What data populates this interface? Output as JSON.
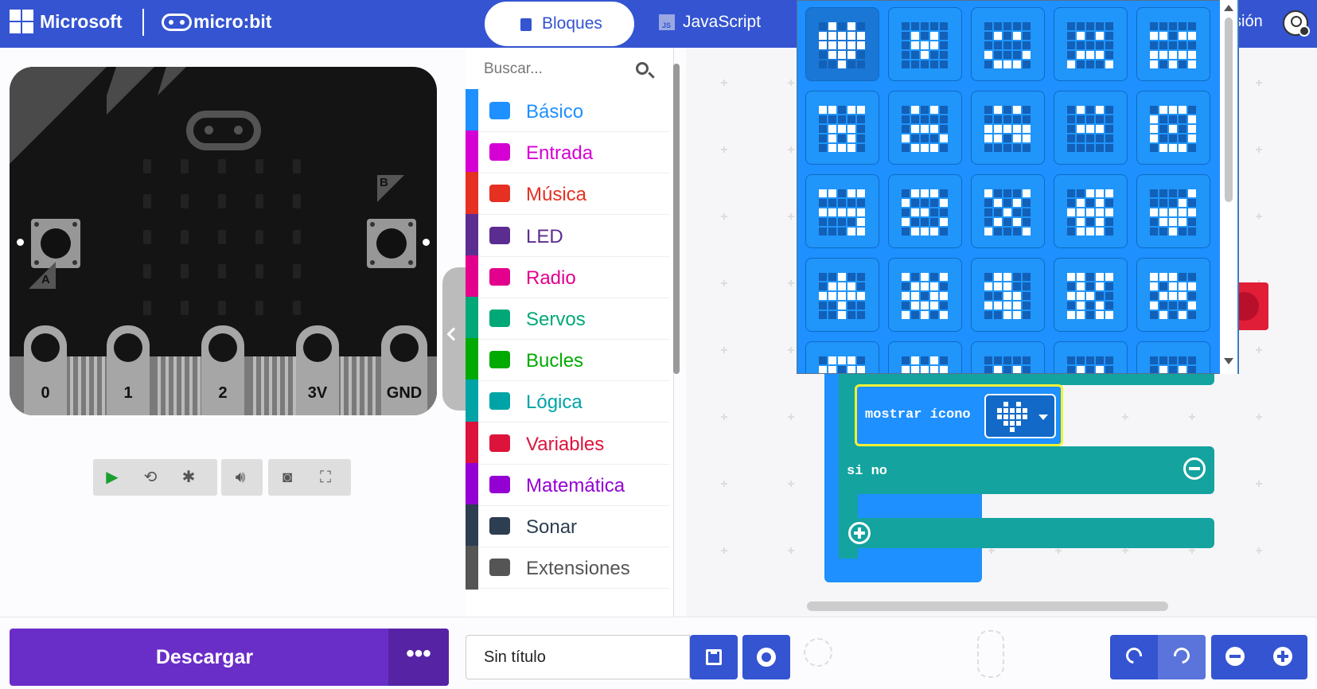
{
  "header": {
    "brand": "Microsoft",
    "product": "micro:bit",
    "tab_blocks": "Bloques",
    "tab_js": "JavaScript",
    "tab_js_badge": "JS",
    "signin": "sión"
  },
  "simulator": {
    "pins": [
      "0",
      "1",
      "2",
      "3V",
      "GND"
    ],
    "button_a": "A",
    "button_b": "B",
    "controls": [
      "play-icon",
      "restart-icon",
      "debug-icon",
      "sound-icon",
      "screenshot-icon",
      "fullscreen-icon"
    ]
  },
  "toolbox": {
    "search_placeholder": "Buscar...",
    "categories": [
      {
        "label": "Básico",
        "color": "#1e90ff",
        "icon": "grid-icon"
      },
      {
        "label": "Entrada",
        "color": "#d400d4",
        "icon": "target-icon"
      },
      {
        "label": "Música",
        "color": "#e63022",
        "icon": "headphones-icon"
      },
      {
        "label": "LED",
        "color": "#5c2d91",
        "icon": "toggle-icon"
      },
      {
        "label": "Radio",
        "color": "#e3008c",
        "icon": "signal-icon"
      },
      {
        "label": "Servos",
        "color": "#00a878",
        "icon": "refresh-icon"
      },
      {
        "label": "Bucles",
        "color": "#00aa00",
        "icon": "loop-icon"
      },
      {
        "label": "Lógica",
        "color": "#00a4a6",
        "icon": "shuffle-icon"
      },
      {
        "label": "Variables",
        "color": "#dc143c",
        "icon": "list-icon"
      },
      {
        "label": "Matemática",
        "color": "#9400d3",
        "icon": "calculator-icon"
      },
      {
        "label": "Sonar",
        "color": "#2c3e50",
        "icon": "puzzle-icon"
      },
      {
        "label": "Extensiones",
        "color": "#555555",
        "icon": "plus-circle-icon"
      }
    ]
  },
  "workspace": {
    "show_icon_label": "mostrar ícono",
    "else_label": "si no"
  },
  "footer": {
    "download": "Descargar",
    "more": "•••",
    "project_title": "Sin título"
  }
}
